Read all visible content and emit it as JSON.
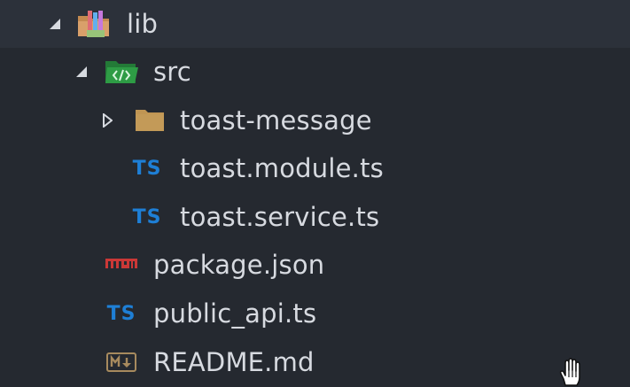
{
  "tree": {
    "items": [
      {
        "label": "lib",
        "icon": "library-folder-icon",
        "expanded": true
      },
      {
        "label": "src",
        "icon": "source-folder-icon",
        "expanded": true
      },
      {
        "label": "toast-message",
        "icon": "folder-icon",
        "expanded": false
      },
      {
        "label": "toast.module.ts",
        "icon": "typescript-icon",
        "icon_text": "TS"
      },
      {
        "label": "toast.service.ts",
        "icon": "typescript-icon",
        "icon_text": "TS"
      },
      {
        "label": "package.json",
        "icon": "npm-icon"
      },
      {
        "label": "public_api.ts",
        "icon": "typescript-icon",
        "icon_text": "TS"
      },
      {
        "label": "README.md",
        "icon": "markdown-icon"
      }
    ]
  },
  "colors": {
    "background": "#252930",
    "selected_row": "#2c313a",
    "text": "#d7dae0",
    "typescript": "#1e7fd6",
    "folder": "#c09553",
    "source_folder": "#2e9c45",
    "npm": "#cb3837",
    "markdown": "#a78a5e"
  }
}
